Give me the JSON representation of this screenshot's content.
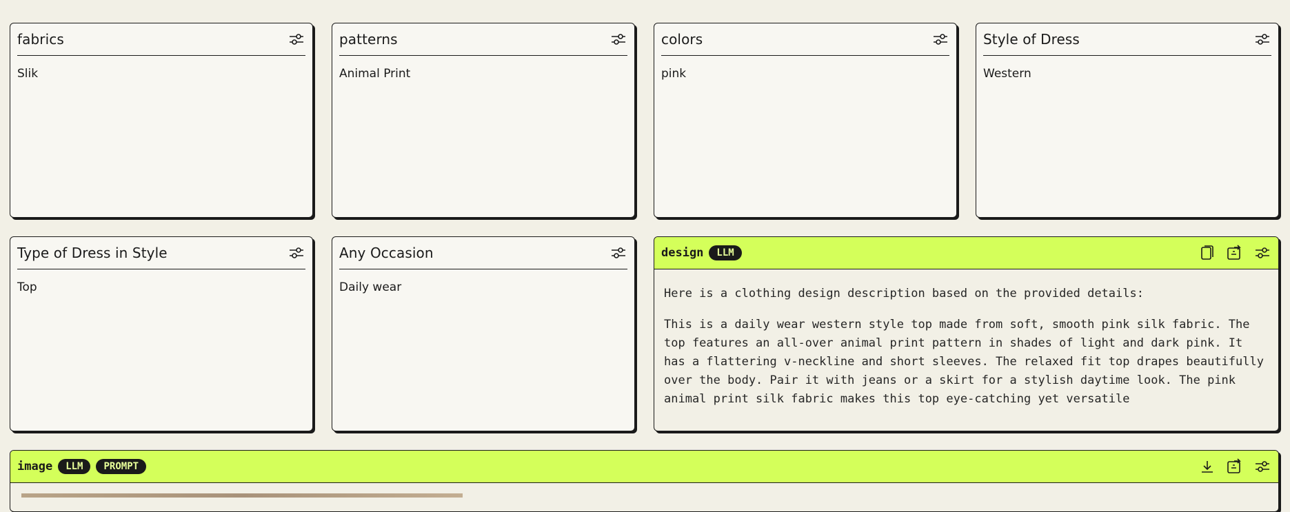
{
  "cards": [
    {
      "title": "fabrics",
      "value": "Slik"
    },
    {
      "title": "patterns",
      "value": "Animal Print"
    },
    {
      "title": "colors",
      "value": "pink"
    },
    {
      "title": "Style of Dress",
      "value": "Western"
    },
    {
      "title": "Type of Dress in Style",
      "value": "Top"
    },
    {
      "title": "Any Occasion",
      "value": "Daily wear"
    }
  ],
  "design": {
    "title": "design",
    "badge": "LLM",
    "paragraphs": [
      "Here is a clothing design description based on the provided details:",
      "This is a daily wear western style top made from soft, smooth pink silk fabric. The top features an all-over animal print pattern in shades of light and dark pink. It has a flattering v-neckline and short sleeves. The relaxed fit top drapes beautifully over the body. Pair it with jeans or a skirt for a stylish daytime look. The pink animal print silk fabric makes this top eye-catching yet versatile"
    ]
  },
  "image": {
    "title": "image",
    "badges": [
      "LLM",
      "PROMPT"
    ]
  },
  "colors": {
    "accent": "#d4ff5a",
    "background": "#f2f0e6",
    "card": "#f8f7f2",
    "ink": "#1a1a1a"
  },
  "icons": {
    "settings": "sliders-icon",
    "copy": "copy-icon",
    "share": "share-icon",
    "download": "download-icon"
  }
}
